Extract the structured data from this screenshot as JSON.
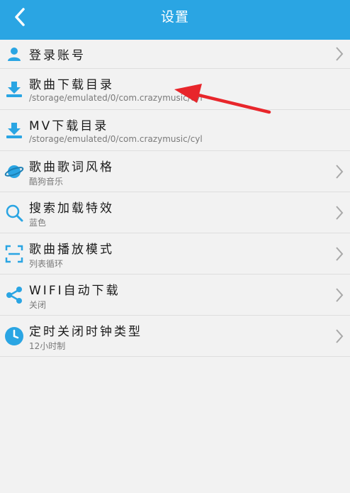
{
  "header": {
    "title": "设置"
  },
  "settings": {
    "items": [
      {
        "title": "登录账号",
        "subtitle": "",
        "icon": "user-icon"
      },
      {
        "title": "歌曲下载目录",
        "subtitle": "/storage/emulated/0/com.crazymusic/cyl",
        "icon": "download-icon"
      },
      {
        "title": "MV下载目录",
        "subtitle": "/storage/emulated/0/com.crazymusic/cyl",
        "icon": "download-icon"
      },
      {
        "title": "歌曲歌词风格",
        "subtitle": "酷狗音乐",
        "icon": "planet-icon"
      },
      {
        "title": "搜索加载特效",
        "subtitle": "蓝色",
        "icon": "search-icon"
      },
      {
        "title": "歌曲播放模式",
        "subtitle": "列表循环",
        "icon": "scan-frame-icon"
      },
      {
        "title": "WIFI自动下载",
        "subtitle": "关闭",
        "icon": "share-icon"
      },
      {
        "title": "定时关闭时钟类型",
        "subtitle": "12小时制",
        "icon": "clock-icon"
      }
    ]
  },
  "colors": {
    "header_bg": "#2aa5e3",
    "icon_blue": "#2aa5e3",
    "annotation_red": "#e8262b"
  }
}
